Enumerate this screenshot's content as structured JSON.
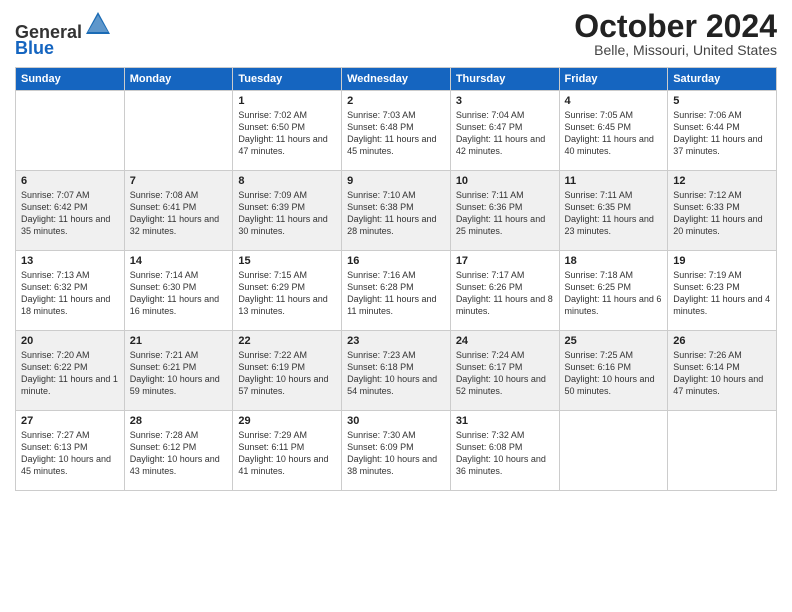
{
  "header": {
    "logo_general": "General",
    "logo_blue": "Blue",
    "month": "October 2024",
    "location": "Belle, Missouri, United States"
  },
  "weekdays": [
    "Sunday",
    "Monday",
    "Tuesday",
    "Wednesday",
    "Thursday",
    "Friday",
    "Saturday"
  ],
  "weeks": [
    [
      {
        "day": "",
        "sunrise": "",
        "sunset": "",
        "daylight": ""
      },
      {
        "day": "",
        "sunrise": "",
        "sunset": "",
        "daylight": ""
      },
      {
        "day": "1",
        "sunrise": "Sunrise: 7:02 AM",
        "sunset": "Sunset: 6:50 PM",
        "daylight": "Daylight: 11 hours and 47 minutes."
      },
      {
        "day": "2",
        "sunrise": "Sunrise: 7:03 AM",
        "sunset": "Sunset: 6:48 PM",
        "daylight": "Daylight: 11 hours and 45 minutes."
      },
      {
        "day": "3",
        "sunrise": "Sunrise: 7:04 AM",
        "sunset": "Sunset: 6:47 PM",
        "daylight": "Daylight: 11 hours and 42 minutes."
      },
      {
        "day": "4",
        "sunrise": "Sunrise: 7:05 AM",
        "sunset": "Sunset: 6:45 PM",
        "daylight": "Daylight: 11 hours and 40 minutes."
      },
      {
        "day": "5",
        "sunrise": "Sunrise: 7:06 AM",
        "sunset": "Sunset: 6:44 PM",
        "daylight": "Daylight: 11 hours and 37 minutes."
      }
    ],
    [
      {
        "day": "6",
        "sunrise": "Sunrise: 7:07 AM",
        "sunset": "Sunset: 6:42 PM",
        "daylight": "Daylight: 11 hours and 35 minutes."
      },
      {
        "day": "7",
        "sunrise": "Sunrise: 7:08 AM",
        "sunset": "Sunset: 6:41 PM",
        "daylight": "Daylight: 11 hours and 32 minutes."
      },
      {
        "day": "8",
        "sunrise": "Sunrise: 7:09 AM",
        "sunset": "Sunset: 6:39 PM",
        "daylight": "Daylight: 11 hours and 30 minutes."
      },
      {
        "day": "9",
        "sunrise": "Sunrise: 7:10 AM",
        "sunset": "Sunset: 6:38 PM",
        "daylight": "Daylight: 11 hours and 28 minutes."
      },
      {
        "day": "10",
        "sunrise": "Sunrise: 7:11 AM",
        "sunset": "Sunset: 6:36 PM",
        "daylight": "Daylight: 11 hours and 25 minutes."
      },
      {
        "day": "11",
        "sunrise": "Sunrise: 7:11 AM",
        "sunset": "Sunset: 6:35 PM",
        "daylight": "Daylight: 11 hours and 23 minutes."
      },
      {
        "day": "12",
        "sunrise": "Sunrise: 7:12 AM",
        "sunset": "Sunset: 6:33 PM",
        "daylight": "Daylight: 11 hours and 20 minutes."
      }
    ],
    [
      {
        "day": "13",
        "sunrise": "Sunrise: 7:13 AM",
        "sunset": "Sunset: 6:32 PM",
        "daylight": "Daylight: 11 hours and 18 minutes."
      },
      {
        "day": "14",
        "sunrise": "Sunrise: 7:14 AM",
        "sunset": "Sunset: 6:30 PM",
        "daylight": "Daylight: 11 hours and 16 minutes."
      },
      {
        "day": "15",
        "sunrise": "Sunrise: 7:15 AM",
        "sunset": "Sunset: 6:29 PM",
        "daylight": "Daylight: 11 hours and 13 minutes."
      },
      {
        "day": "16",
        "sunrise": "Sunrise: 7:16 AM",
        "sunset": "Sunset: 6:28 PM",
        "daylight": "Daylight: 11 hours and 11 minutes."
      },
      {
        "day": "17",
        "sunrise": "Sunrise: 7:17 AM",
        "sunset": "Sunset: 6:26 PM",
        "daylight": "Daylight: 11 hours and 8 minutes."
      },
      {
        "day": "18",
        "sunrise": "Sunrise: 7:18 AM",
        "sunset": "Sunset: 6:25 PM",
        "daylight": "Daylight: 11 hours and 6 minutes."
      },
      {
        "day": "19",
        "sunrise": "Sunrise: 7:19 AM",
        "sunset": "Sunset: 6:23 PM",
        "daylight": "Daylight: 11 hours and 4 minutes."
      }
    ],
    [
      {
        "day": "20",
        "sunrise": "Sunrise: 7:20 AM",
        "sunset": "Sunset: 6:22 PM",
        "daylight": "Daylight: 11 hours and 1 minute."
      },
      {
        "day": "21",
        "sunrise": "Sunrise: 7:21 AM",
        "sunset": "Sunset: 6:21 PM",
        "daylight": "Daylight: 10 hours and 59 minutes."
      },
      {
        "day": "22",
        "sunrise": "Sunrise: 7:22 AM",
        "sunset": "Sunset: 6:19 PM",
        "daylight": "Daylight: 10 hours and 57 minutes."
      },
      {
        "day": "23",
        "sunrise": "Sunrise: 7:23 AM",
        "sunset": "Sunset: 6:18 PM",
        "daylight": "Daylight: 10 hours and 54 minutes."
      },
      {
        "day": "24",
        "sunrise": "Sunrise: 7:24 AM",
        "sunset": "Sunset: 6:17 PM",
        "daylight": "Daylight: 10 hours and 52 minutes."
      },
      {
        "day": "25",
        "sunrise": "Sunrise: 7:25 AM",
        "sunset": "Sunset: 6:16 PM",
        "daylight": "Daylight: 10 hours and 50 minutes."
      },
      {
        "day": "26",
        "sunrise": "Sunrise: 7:26 AM",
        "sunset": "Sunset: 6:14 PM",
        "daylight": "Daylight: 10 hours and 47 minutes."
      }
    ],
    [
      {
        "day": "27",
        "sunrise": "Sunrise: 7:27 AM",
        "sunset": "Sunset: 6:13 PM",
        "daylight": "Daylight: 10 hours and 45 minutes."
      },
      {
        "day": "28",
        "sunrise": "Sunrise: 7:28 AM",
        "sunset": "Sunset: 6:12 PM",
        "daylight": "Daylight: 10 hours and 43 minutes."
      },
      {
        "day": "29",
        "sunrise": "Sunrise: 7:29 AM",
        "sunset": "Sunset: 6:11 PM",
        "daylight": "Daylight: 10 hours and 41 minutes."
      },
      {
        "day": "30",
        "sunrise": "Sunrise: 7:30 AM",
        "sunset": "Sunset: 6:09 PM",
        "daylight": "Daylight: 10 hours and 38 minutes."
      },
      {
        "day": "31",
        "sunrise": "Sunrise: 7:32 AM",
        "sunset": "Sunset: 6:08 PM",
        "daylight": "Daylight: 10 hours and 36 minutes."
      },
      {
        "day": "",
        "sunrise": "",
        "sunset": "",
        "daylight": ""
      },
      {
        "day": "",
        "sunrise": "",
        "sunset": "",
        "daylight": ""
      }
    ]
  ]
}
